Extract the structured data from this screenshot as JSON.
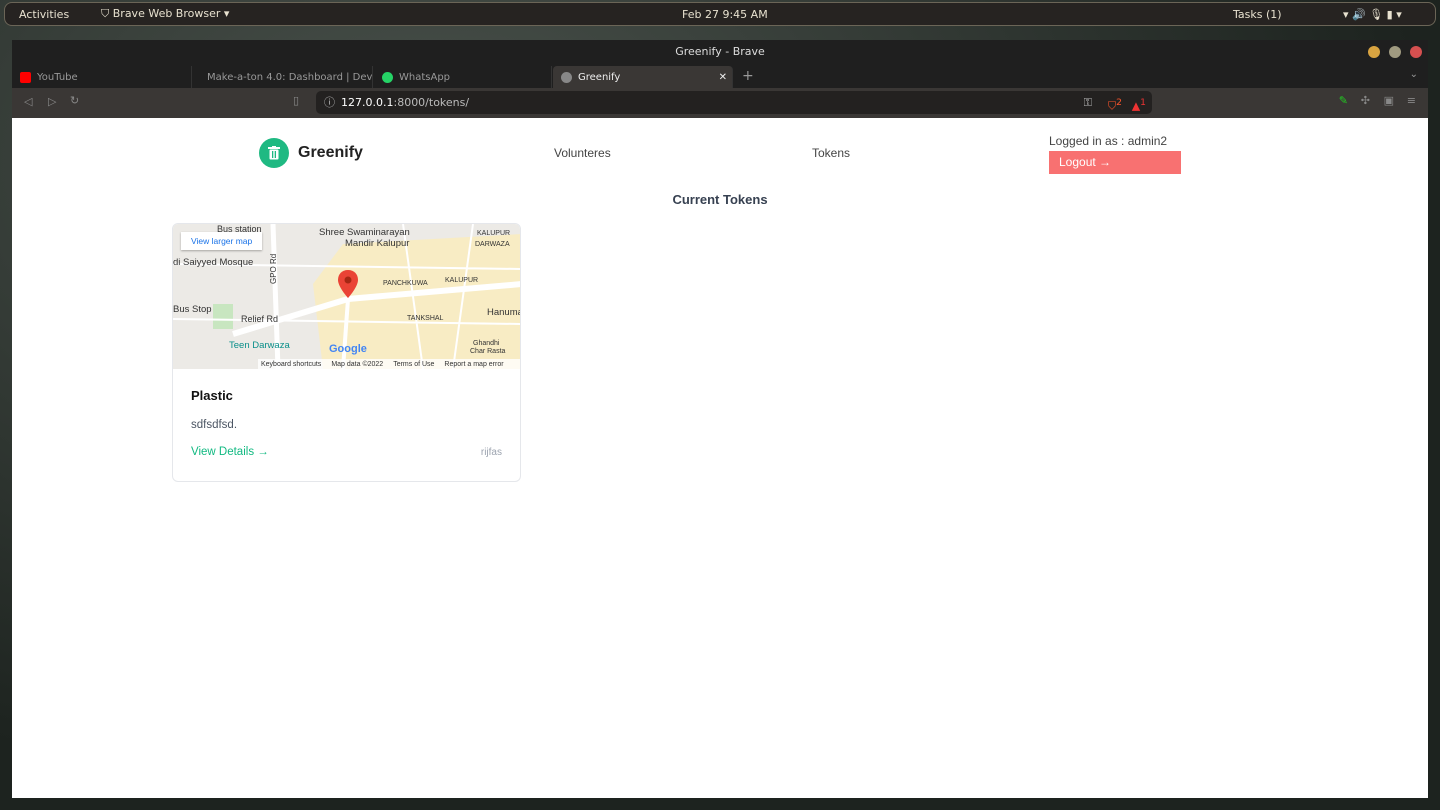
{
  "system": {
    "activities": "Activities",
    "app": "Brave Web Browser",
    "datetime": "Feb 27  9:45 AM",
    "tasks": "Tasks (1)"
  },
  "window": {
    "title": "Greenify - Brave"
  },
  "tabs": [
    {
      "label": "YouTube",
      "color": "#ff0000"
    },
    {
      "label": "Make-a-ton 4.0: Dashboard | Devfolio",
      "color": "#3770ff"
    },
    {
      "label": "WhatsApp",
      "color": "#25d366"
    },
    {
      "label": "Greenify",
      "color": "#888888",
      "active": true
    }
  ],
  "address": {
    "host": "127.0.0.1",
    "rest": ":8000/tokens/"
  },
  "badges": {
    "shield": "2",
    "rewards": "1"
  },
  "header": {
    "brand": "Greenify",
    "nav": [
      "Volunteres",
      "Tokens"
    ],
    "logged_in": "Logged in as : admin2",
    "logout": "Logout →"
  },
  "main": {
    "heading": "Current Tokens",
    "cards": [
      {
        "title": "Plastic",
        "description": "sdfsdfsd.",
        "link": "View Details  →",
        "author": "rijfas",
        "map": {
          "view_larger": "View larger map",
          "labels": [
            "Bus station",
            "Shree Swaminarayan",
            "Mandir Kalupur",
            "KALUPUR",
            "DARWAZA",
            "di Saiyyed Mosque",
            "GPO Rd",
            "PANCHKUWA",
            "KALUPUR",
            "Bus Stop",
            "Relief Rd",
            "TANKSHAL",
            "Hanuma",
            "Teen Darwaza",
            "Ghandhi",
            "Char Rasta"
          ],
          "attribution": [
            "Keyboard shortcuts",
            "Map data ©2022",
            "Terms of Use",
            "Report a map error"
          ],
          "logo": "Google"
        }
      }
    ]
  },
  "colors": {
    "accent": "#10b981",
    "logout": "#f87171"
  }
}
